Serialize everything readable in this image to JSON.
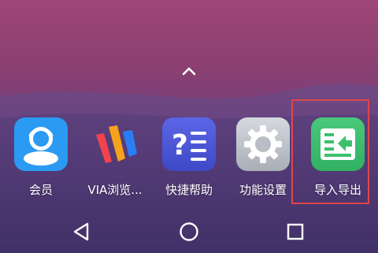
{
  "dock": {
    "apps": [
      {
        "label": "会员",
        "icon": "member-avatar-icon",
        "color": "#2b9af3"
      },
      {
        "label": "VIA浏览...",
        "icon": "via-browser-icon",
        "color": "#f7a21b"
      },
      {
        "label": "快捷帮助",
        "icon": "help-list-icon",
        "color": "#4d5bd9"
      },
      {
        "label": "功能设置",
        "icon": "settings-gear-icon",
        "color": "#b8bcc4"
      },
      {
        "label": "导入导出",
        "icon": "import-export-icon",
        "color": "#3fbf6e"
      }
    ]
  },
  "colors": {
    "highlight": "#e0464a",
    "nav_icon": "#ffffff"
  },
  "navigation": {
    "back": "back-triangle-icon",
    "home": "home-circle-icon",
    "recents": "recents-square-icon"
  }
}
